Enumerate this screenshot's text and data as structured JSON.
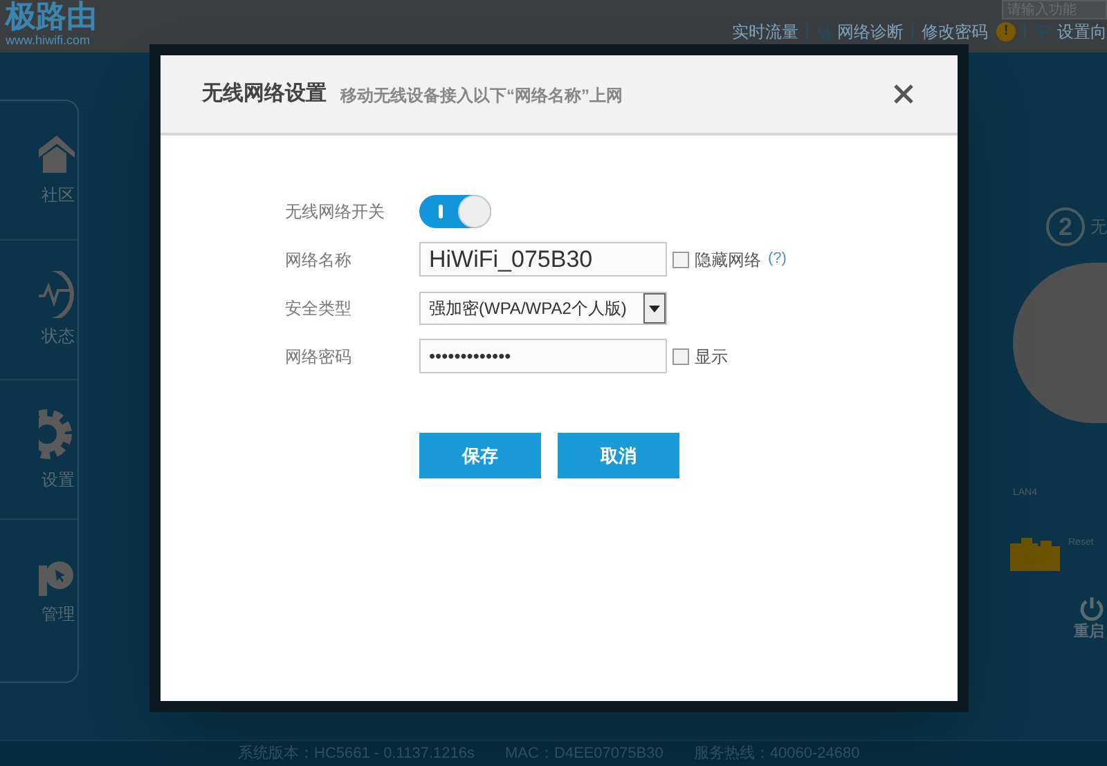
{
  "header": {
    "logo": "极路由",
    "url": "www.hiwifi.com",
    "search": {
      "placeholder": "请输入功能"
    },
    "links": [
      {
        "label": "实时流量",
        "kind": "plain"
      },
      {
        "label": "网络诊断",
        "kind": "stethoscope"
      },
      {
        "label": "修改密码",
        "kind": "alert",
        "badge": "!"
      },
      {
        "label": "设置向",
        "kind": "signpost"
      }
    ]
  },
  "sidebar": {
    "items": [
      {
        "label": "社区"
      },
      {
        "label": "状态"
      },
      {
        "label": "设置"
      },
      {
        "label": "管理"
      }
    ]
  },
  "right_panel": {
    "step": "2",
    "step_label": "无",
    "port_label": "LAN4",
    "reset_label": "Reset",
    "restart_label": "重启"
  },
  "dialog": {
    "title": "无线网络设置",
    "subtitle": "移动无线设备接入以下“网络名称”上网",
    "fields": [
      {
        "kind": "toggle",
        "label": "无线网络开关",
        "on": true
      },
      {
        "kind": "text",
        "label": "网络名称",
        "value": "HiWiFi_075B30",
        "checkbox": {
          "label": "隐藏网络",
          "checked": false
        },
        "help": "(?)"
      },
      {
        "kind": "select",
        "label": "安全类型",
        "value": "强加密(WPA/WPA2个人版)"
      },
      {
        "kind": "password",
        "label": "网络密码",
        "value": "•••••••••••••",
        "checkbox": {
          "label": "显示",
          "checked": false
        }
      }
    ],
    "buttons": [
      "保存",
      "取消"
    ]
  },
  "status_bar": [
    "系统版本：HC5661 - 0.1137.1216s",
    "MAC：D4EE07075B30",
    "服务热线：40060-24680"
  ]
}
